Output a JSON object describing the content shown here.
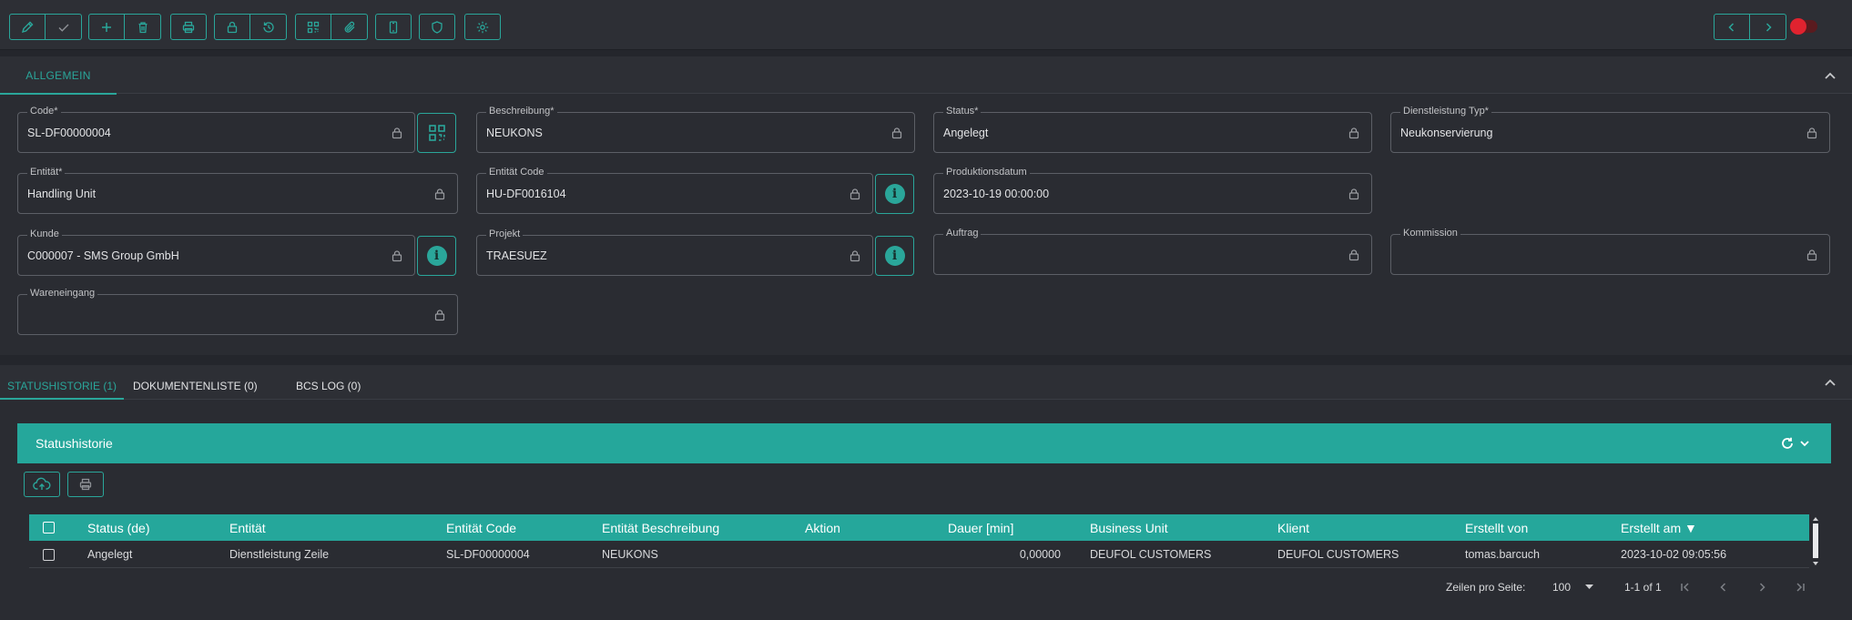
{
  "toolbar": {
    "groups": [
      [
        "pencil-icon",
        "check-icon"
      ],
      [
        "plus-icon",
        "trash-icon"
      ],
      [
        "printer-icon"
      ],
      [
        "lock-icon",
        "history-icon"
      ],
      [
        "qr-code-icon",
        "paperclip-icon"
      ],
      [
        "mobile-icon"
      ],
      [
        "shield-icon"
      ],
      [
        "gear-icon"
      ]
    ],
    "nav": [
      "chevron-left-icon",
      "chevron-right-icon"
    ],
    "toggle_color": "#e0232f"
  },
  "general_panel": {
    "tab_label": "ALLGEMEIN",
    "fields": {
      "code": {
        "label": "Code*",
        "value": "SL-DF00000004"
      },
      "beschreibung": {
        "label": "Beschreibung*",
        "value": "NEUKONS"
      },
      "status": {
        "label": "Status*",
        "value": "Angelegt"
      },
      "dienstleistung_typ": {
        "label": "Dienstleistung Typ*",
        "value": "Neukonservierung"
      },
      "entitaet": {
        "label": "Entität*",
        "value": "Handling Unit"
      },
      "entitaet_code": {
        "label": "Entität Code",
        "value": "HU-DF0016104"
      },
      "produktionsdatum": {
        "label": "Produktionsdatum",
        "value": "2023-10-19 00:00:00"
      },
      "kunde": {
        "label": "Kunde",
        "value": "C000007 - SMS Group GmbH"
      },
      "projekt": {
        "label": "Projekt",
        "value": "TRAESUEZ"
      },
      "auftrag": {
        "label": "Auftrag",
        "value": ""
      },
      "kommission": {
        "label": "Kommission",
        "value": ""
      },
      "wareneingang": {
        "label": "Wareneingang",
        "value": ""
      }
    }
  },
  "bottom_tabs": [
    {
      "label": "STATUSHISTORIE (1)",
      "active": true
    },
    {
      "label": "DOKUMENTENLISTE (0)",
      "active": false
    },
    {
      "label": "BCS LOG (0)",
      "active": false
    }
  ],
  "status_history": {
    "title": "Statushistorie",
    "columns": [
      "Status (de)",
      "Entität",
      "Entität Code",
      "Entität Beschreibung",
      "Aktion",
      "Dauer [min]",
      "Business Unit",
      "Klient",
      "Erstellt von",
      "Erstellt am ▼"
    ],
    "rows": [
      [
        "Angelegt",
        "Dienstleistung Zeile",
        "SL-DF00000004",
        "NEUKONS",
        "",
        "0,00000",
        "DEUFOL CUSTOMERS",
        "DEUFOL CUSTOMERS",
        "tomas.barcuch",
        "2023-10-02 09:05:56"
      ]
    ],
    "pagination": {
      "rows_per_page_label": "Zeilen pro Seite:",
      "rows_per_page": "100",
      "range": "1-1 of 1"
    }
  },
  "colors": {
    "accent": "#25a79b",
    "background": "#24262c",
    "panel": "#2a2c32"
  }
}
